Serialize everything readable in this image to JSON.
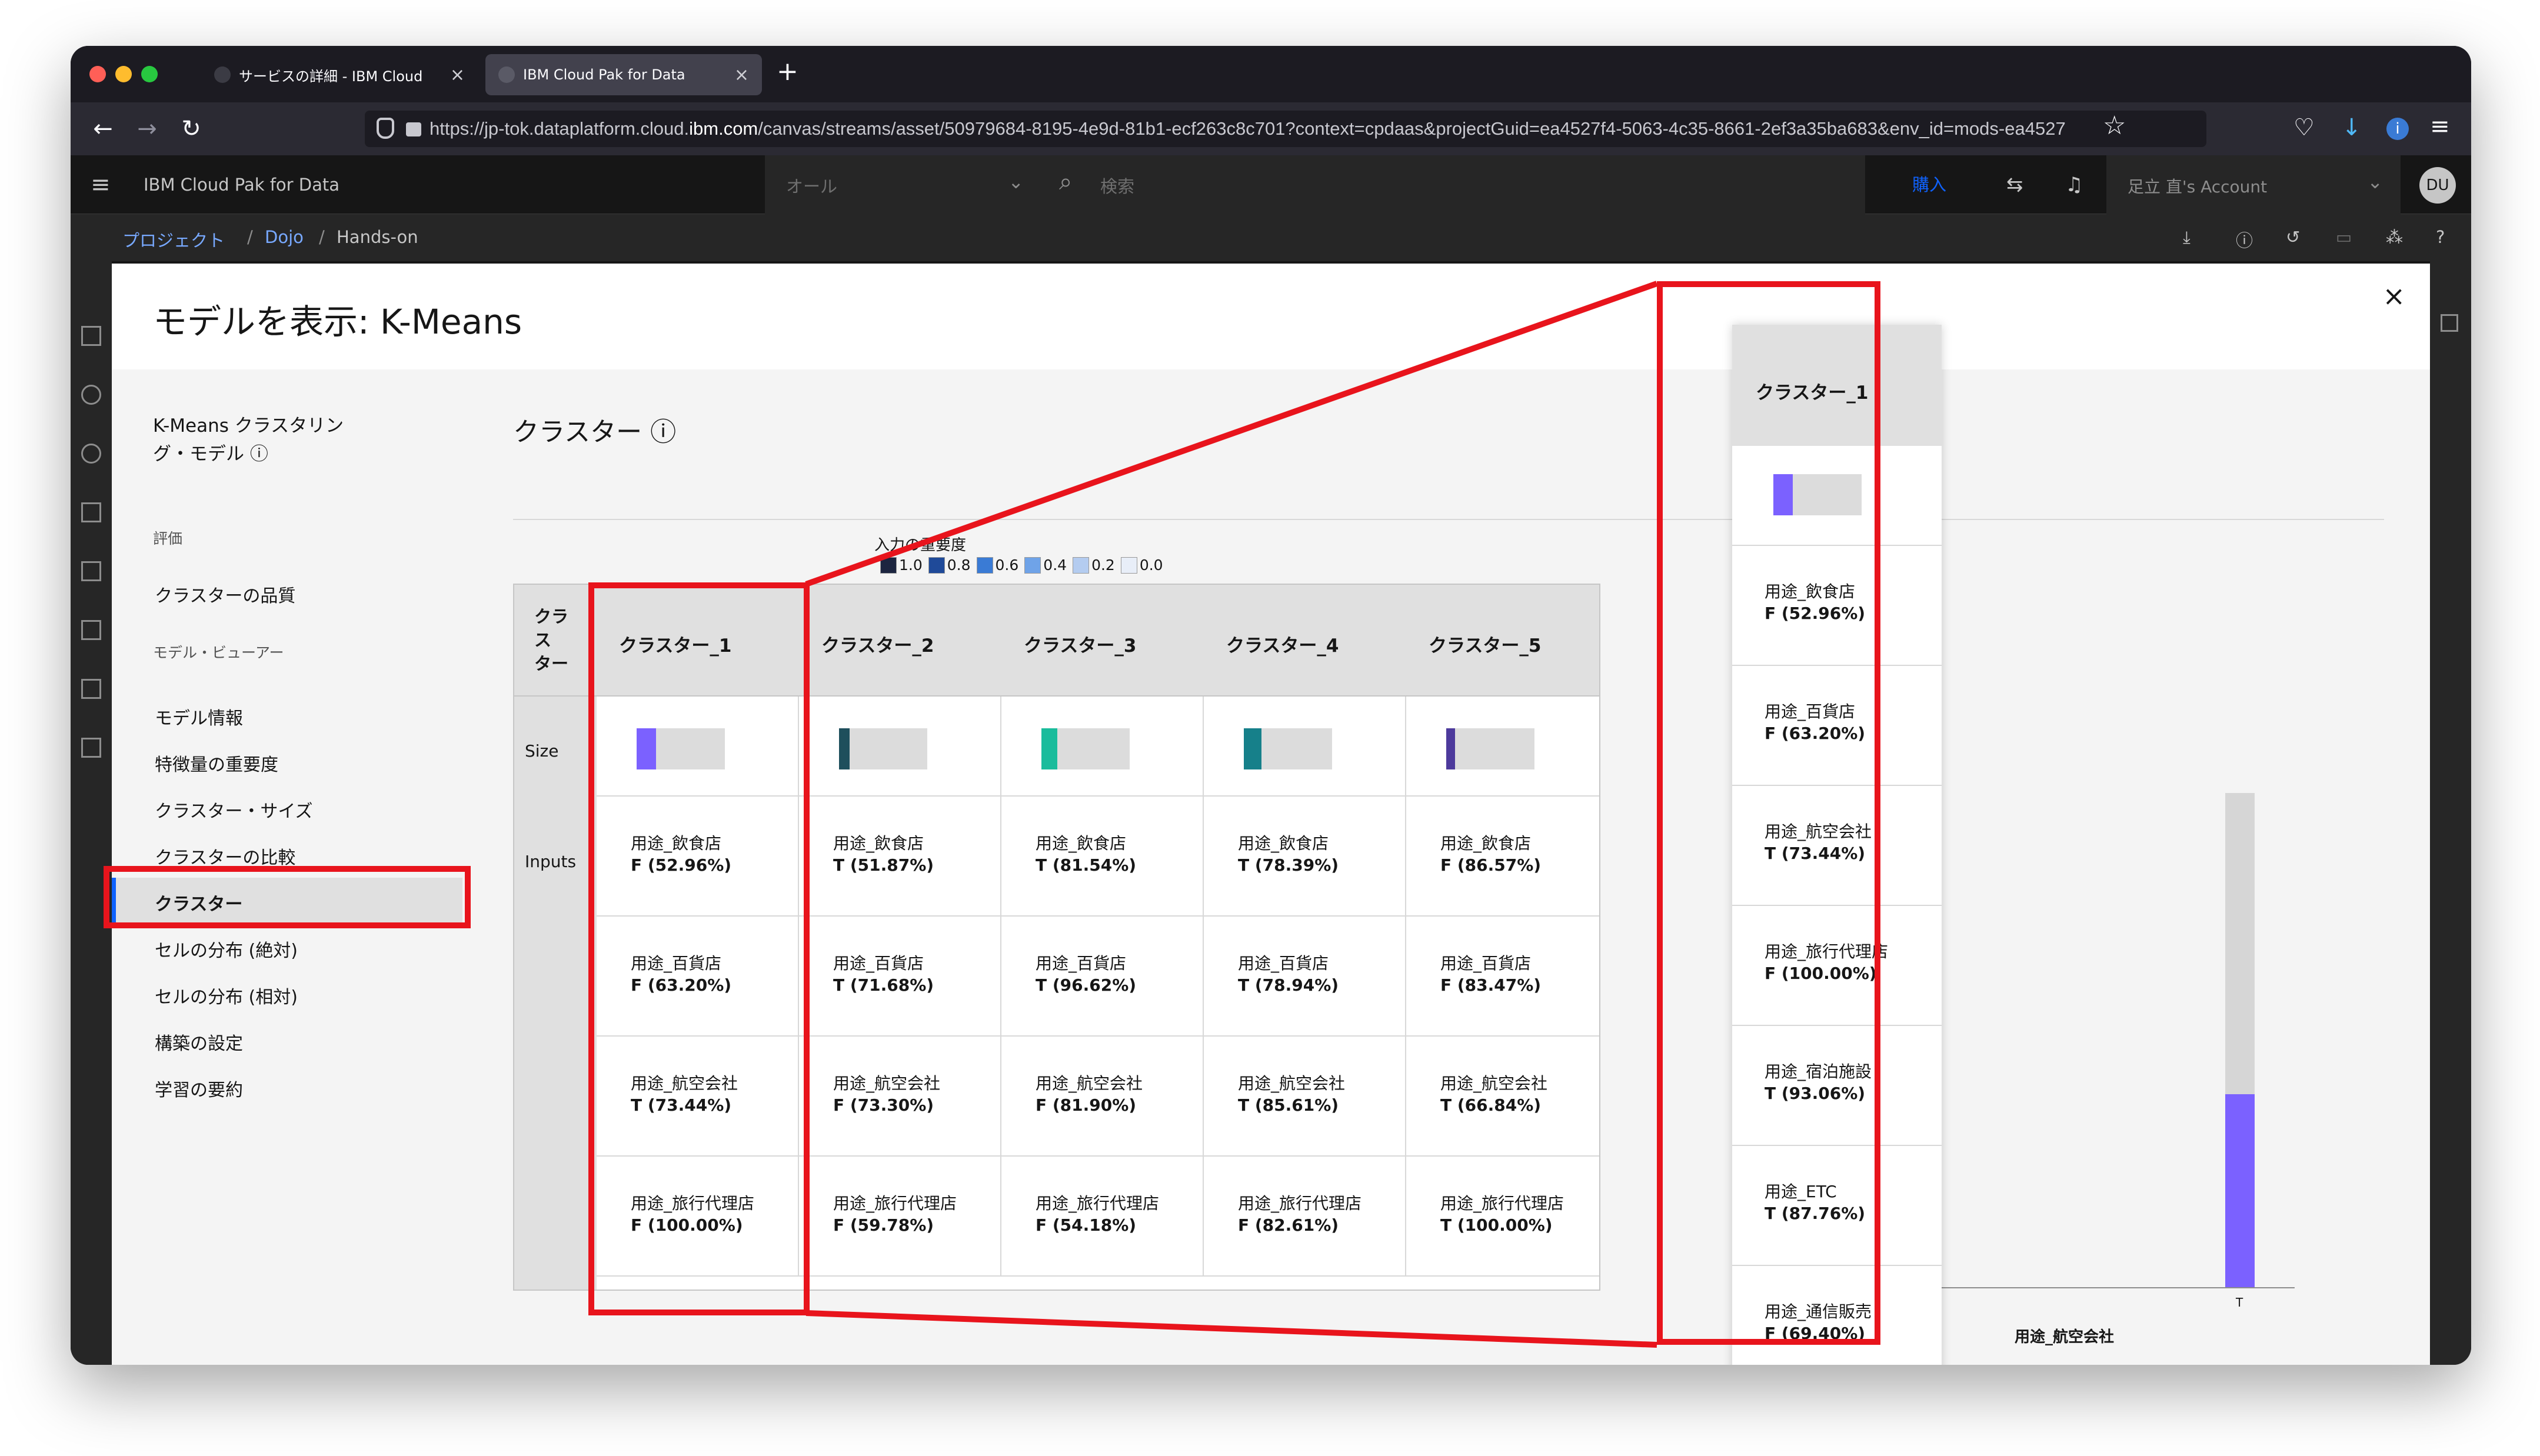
{
  "browser": {
    "tabs": [
      {
        "title": "サービスの詳細 - IBM Cloud",
        "active": false
      },
      {
        "title": "IBM Cloud Pak for Data",
        "active": true
      }
    ],
    "new_tab": "+",
    "close": "×",
    "url_prefix": "https://jp-tok.dataplatform.cloud.",
    "url_host": "ibm.com",
    "url_rest": "/canvas/streams/asset/50979684-8195-4e9d-81b1-ecf263c8c701?context=cpdaas&projectGuid=ea4527f4-5063-4c35-8661-2ef3a35ba683&env_id=mods-ea4527",
    "traffic_colors": [
      "#ff5f57",
      "#febc2e",
      "#28c840"
    ]
  },
  "app_header": {
    "title": "IBM Cloud Pak for Data",
    "scope": "オール",
    "search_placeholder": "検索",
    "buy": "購入",
    "account": "足立 直's Account",
    "avatar": "DU"
  },
  "breadcrumb": {
    "items": [
      "プロジェクト",
      "Dojo",
      "Hands-on"
    ],
    "sep": "/"
  },
  "modal": {
    "title": "モデルを表示: K-Means",
    "close": "×"
  },
  "left_nav": {
    "model_title_line1": "K-Means クラスタリン",
    "model_title_line2": "グ・モデル ⓘ",
    "section_eval": "評価",
    "item_quality": "クラスターの品質",
    "section_viewer": "モデル・ビューアー",
    "items": [
      "モデル情報",
      "特徴量の重要度",
      "クラスター・サイズ",
      "クラスターの比較",
      "クラスター",
      "セルの分布 (絶対)",
      "セルの分布 (相対)",
      "構築の設定",
      "学習の要約"
    ],
    "active_index": 4
  },
  "main": {
    "section_title": "クラスター ⓘ",
    "legend_title": "入力の重要度",
    "legend": [
      {
        "label": "1.0",
        "color": "#1c2540"
      },
      {
        "label": "0.8",
        "color": "#1f4a99"
      },
      {
        "label": "0.6",
        "color": "#3a7bd5"
      },
      {
        "label": "0.4",
        "color": "#6fa3e8"
      },
      {
        "label": "0.2",
        "color": "#b4ccf0"
      },
      {
        "label": "0.0",
        "color": "#e8eef8"
      }
    ],
    "corner_header": [
      "クラ",
      "ス",
      "ター"
    ],
    "row_labels": {
      "size": "Size",
      "inputs": "Inputs"
    },
    "clusters": [
      {
        "name": "クラスター_1",
        "size": 0.22,
        "color": "#7b61ff",
        "inputs": [
          {
            "f": "用途_飲食店",
            "v": "F (52.96%)"
          },
          {
            "f": "用途_百貨店",
            "v": "F (63.20%)"
          },
          {
            "f": "用途_航空会社",
            "v": "T (73.44%)"
          },
          {
            "f": "用途_旅行代理店",
            "v": "F (100.00%)"
          }
        ]
      },
      {
        "name": "クラスター_2",
        "size": 0.12,
        "color": "#1e4f5c",
        "inputs": [
          {
            "f": "用途_飲食店",
            "v": "T (51.87%)"
          },
          {
            "f": "用途_百貨店",
            "v": "T (71.68%)"
          },
          {
            "f": "用途_航空会社",
            "v": "F (73.30%)"
          },
          {
            "f": "用途_旅行代理店",
            "v": "F (59.78%)"
          }
        ]
      },
      {
        "name": "クラスター_3",
        "size": 0.18,
        "color": "#1abc9c",
        "inputs": [
          {
            "f": "用途_飲食店",
            "v": "T (81.54%)"
          },
          {
            "f": "用途_百貨店",
            "v": "T (96.62%)"
          },
          {
            "f": "用途_航空会社",
            "v": "F (81.90%)"
          },
          {
            "f": "用途_旅行代理店",
            "v": "F (54.18%)"
          }
        ]
      },
      {
        "name": "クラスター_4",
        "size": 0.2,
        "color": "#16808a",
        "inputs": [
          {
            "f": "用途_飲食店",
            "v": "T (78.39%)"
          },
          {
            "f": "用途_百貨店",
            "v": "T (78.94%)"
          },
          {
            "f": "用途_航空会社",
            "v": "T (85.61%)"
          },
          {
            "f": "用途_旅行代理店",
            "v": "F (82.61%)"
          }
        ]
      },
      {
        "name": "クラスター_5",
        "size": 0.1,
        "color": "#4d3a9c",
        "inputs": [
          {
            "f": "用途_飲食店",
            "v": "F (86.57%)"
          },
          {
            "f": "用途_百貨店",
            "v": "F (83.47%)"
          },
          {
            "f": "用途_航空会社",
            "v": "T (66.84%)"
          },
          {
            "f": "用途_旅行代理店",
            "v": "T (100.00%)"
          }
        ]
      }
    ]
  },
  "zoom": {
    "header": "クラスター_1",
    "size": 0.22,
    "color": "#7b61ff",
    "rows": [
      {
        "f": "用途_飲食店",
        "v": "F (52.96%)"
      },
      {
        "f": "用途_百貨店",
        "v": "F (63.20%)"
      },
      {
        "f": "用途_航空会社",
        "v": "T (73.44%)"
      },
      {
        "f": "用途_旅行代理店",
        "v": "F (100.00%)"
      },
      {
        "f": "用途_宿泊施設",
        "v": "T (93.06%)"
      },
      {
        "f": "用途_ETC",
        "v": "T (87.76%)"
      },
      {
        "f": "用途_通信販売",
        "v": "F (69.40%)"
      }
    ]
  },
  "chart_fragment": {
    "x_tick": "T",
    "x_label": "用途_航空会社",
    "t_share": 0.39
  }
}
